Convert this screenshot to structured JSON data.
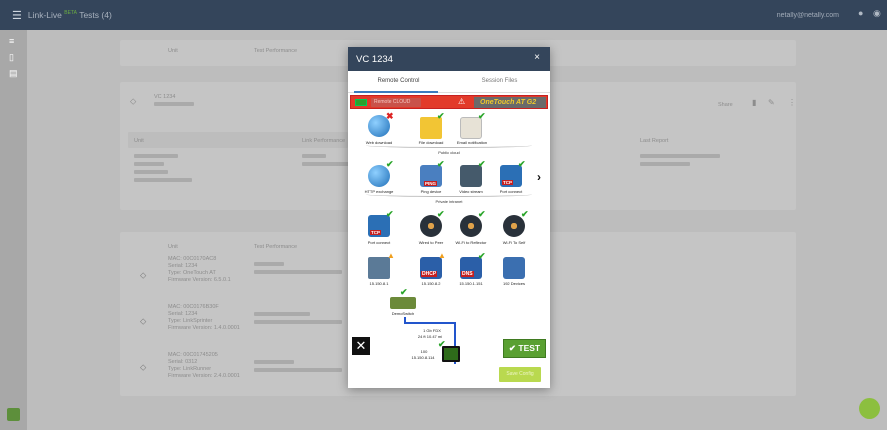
{
  "header": {
    "menu_icon": "hamburger-icon",
    "brand": "Link-Live",
    "brand_badge": "BETA",
    "brand_suffix": "Tests (4)",
    "user": "netally@netally.com",
    "bell_icon": "bell-icon",
    "info_icon": "info-icon"
  },
  "sidebar": {
    "items": [
      "menu-icon",
      "phone-icon",
      "document-icon",
      "settings-icon"
    ]
  },
  "background": {
    "top_card": {
      "col1": "Unit",
      "col2": "Test Performance"
    },
    "device_card": {
      "title": "VC 1234",
      "actions": {
        "share": "Share"
      },
      "sections": [
        "Unit",
        "Link Performance",
        "Last Report"
      ]
    },
    "list_card": {
      "col1": "Unit",
      "col2": "Test Performance",
      "rows": [
        {
          "mac": "MAC: 00C0170AC8",
          "serial": "Serial: 1234",
          "type": "Type: OneTouch AT",
          "fw": "Firmware Version: 6.5.0.1"
        },
        {
          "mac": "MAC: 00C0176B30F",
          "serial": "Serial: 1234",
          "type": "Type: LinkSprinter",
          "fw": "Firmware Version: 1.4.0.0001"
        },
        {
          "mac": "MAC: 00C01745205",
          "serial": "Serial: 0312",
          "type": "Type: LinkRunner",
          "fw": "Firmware Version: 2.4.0.0001"
        }
      ]
    }
  },
  "modal": {
    "title": "VC 1234",
    "close": "×",
    "tabs": [
      "Remote Control",
      "Session Files"
    ],
    "active_tab": 0,
    "status_pill": "Remote CLOUD",
    "device_name": "OneTouch AT G2",
    "tests": {
      "public_cloud": {
        "label": "Public cloud",
        "items": [
          {
            "label": "Web download",
            "icon": "globe-icon",
            "status": "fail"
          },
          {
            "label": "File download",
            "icon": "folder-icon",
            "status": "pass"
          },
          {
            "label": "Email notification",
            "icon": "email-icon",
            "status": "pass"
          }
        ]
      },
      "private_intranet": {
        "label": "Private intranet",
        "items": [
          {
            "label": "HTTP exchange",
            "icon": "globe-icon",
            "status": "pass"
          },
          {
            "label": "Ping device",
            "icon": "ping-icon",
            "status": "pass"
          },
          {
            "label": "Video stream",
            "icon": "video-icon",
            "status": "pass"
          },
          {
            "label": "Port connect",
            "icon": "tcp-icon",
            "status": "pass"
          }
        ]
      },
      "performance": {
        "items": [
          {
            "label": "Port connect",
            "icon": "tcp-icon",
            "status": "pass"
          },
          {
            "label": "Wired to Peer",
            "icon": "gauge-icon",
            "status": "pass"
          },
          {
            "label": "Wi-Fi to Reflector",
            "icon": "gauge-icon",
            "status": "pass"
          },
          {
            "label": "Wi-Fi To Self",
            "icon": "gauge-icon",
            "status": "pass"
          }
        ]
      },
      "services": {
        "items": [
          {
            "label": "15.150.8.1",
            "icon": "router-icon",
            "status": "warn"
          },
          {
            "label": "15.150.8.2",
            "icon": "dhcp-icon",
            "status": "warn"
          },
          {
            "label": "15.150.1.151",
            "icon": "dns-icon",
            "status": "pass"
          },
          {
            "label": "192 Devices",
            "icon": "devices-icon",
            "status": "pass"
          }
        ]
      }
    },
    "switch_label": "DemoSwitch",
    "link": {
      "speed": "1 Gb FDX",
      "port": "24 ft 10.47 mi",
      "poe": "100",
      "ip": "15.150.8.114"
    },
    "test_button": "TEST",
    "small_button": "Save Config",
    "more_icon": "chevron-right-icon",
    "tools_icon": "tools-icon"
  }
}
